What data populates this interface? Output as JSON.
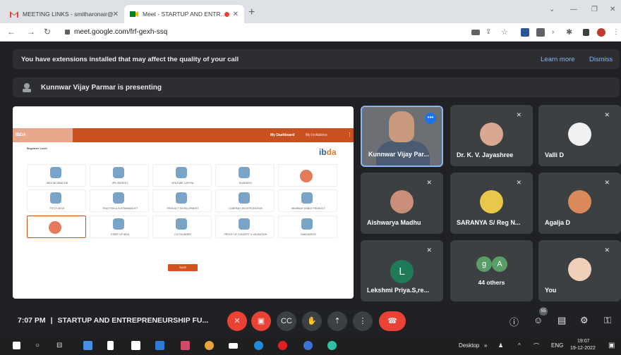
{
  "browser": {
    "tabs": [
      {
        "title": "MEETING LINKS - smitharonair@ ...",
        "active": false
      },
      {
        "title": "Meet - STARTUP AND ENTR...",
        "active": true
      }
    ],
    "url": "meet.google.com/frf-gexh-ssq"
  },
  "banner": {
    "message": "You have extensions installed that may affect the quality of your call",
    "learn_more": "Learn more",
    "dismiss": "Dismiss"
  },
  "presenting": "Kunnwar Vijay Parmar is presenting",
  "shared_screen": {
    "logo_text": "ibda",
    "dashboard_label": "My Dashboard",
    "invitations_label": "My Invitations",
    "level_label": "Beginner Level",
    "cards": [
      {
        "label": "IDEA INCUBATION"
      },
      {
        "label": "IPR (PATENT)"
      },
      {
        "label": "VENTURE CAPITAL"
      },
      {
        "label": "BUSINESS"
      },
      {
        "label": ""
      },
      {
        "label": "PITCH DECK"
      },
      {
        "label": "TRACTION & SUSTAINABILITY"
      },
      {
        "label": "PRODUCT DEVELOPMENT"
      },
      {
        "label": "COMPANY INCORPORATION"
      },
      {
        "label": "MINIMUM VIABLE PRODUCT"
      },
      {
        "label": ""
      },
      {
        "label": "START UP IDEA"
      },
      {
        "label": "CO-FOUNDER"
      },
      {
        "label": "PROOF OF CONCEPT & VALIDATION"
      },
      {
        "label": "INNOVATION"
      }
    ],
    "submit_label": "SAVE"
  },
  "participants": [
    {
      "name": "Kunnwar Vijay Par...",
      "speaking": true
    },
    {
      "name": "Dr. K. V. Jayashree"
    },
    {
      "name": "Valli D"
    },
    {
      "name": "Aishwarya Madhu"
    },
    {
      "name": "SARANYA S/ Reg N..."
    },
    {
      "name": "Agalja D"
    },
    {
      "name": "Lekshmi Priya.S,re...",
      "initial": "L"
    },
    {
      "name": "44 others",
      "initials": [
        "g",
        "A"
      ]
    },
    {
      "name": "You"
    }
  ],
  "meeting": {
    "time": "7:07 PM",
    "separator": "|",
    "title": "STARTUP AND ENTREPRENEURSHIP FU...",
    "people_count": "55"
  },
  "taskbar": {
    "desktop": "Desktop",
    "lang": "ENG",
    "time": "19:07",
    "date": "19-12-2022"
  },
  "colors": {
    "accent": "#8ab4f8",
    "danger": "#ea4335",
    "bg": "#202124",
    "tile": "#3c4043",
    "ibda_orange": "#c8511f"
  }
}
